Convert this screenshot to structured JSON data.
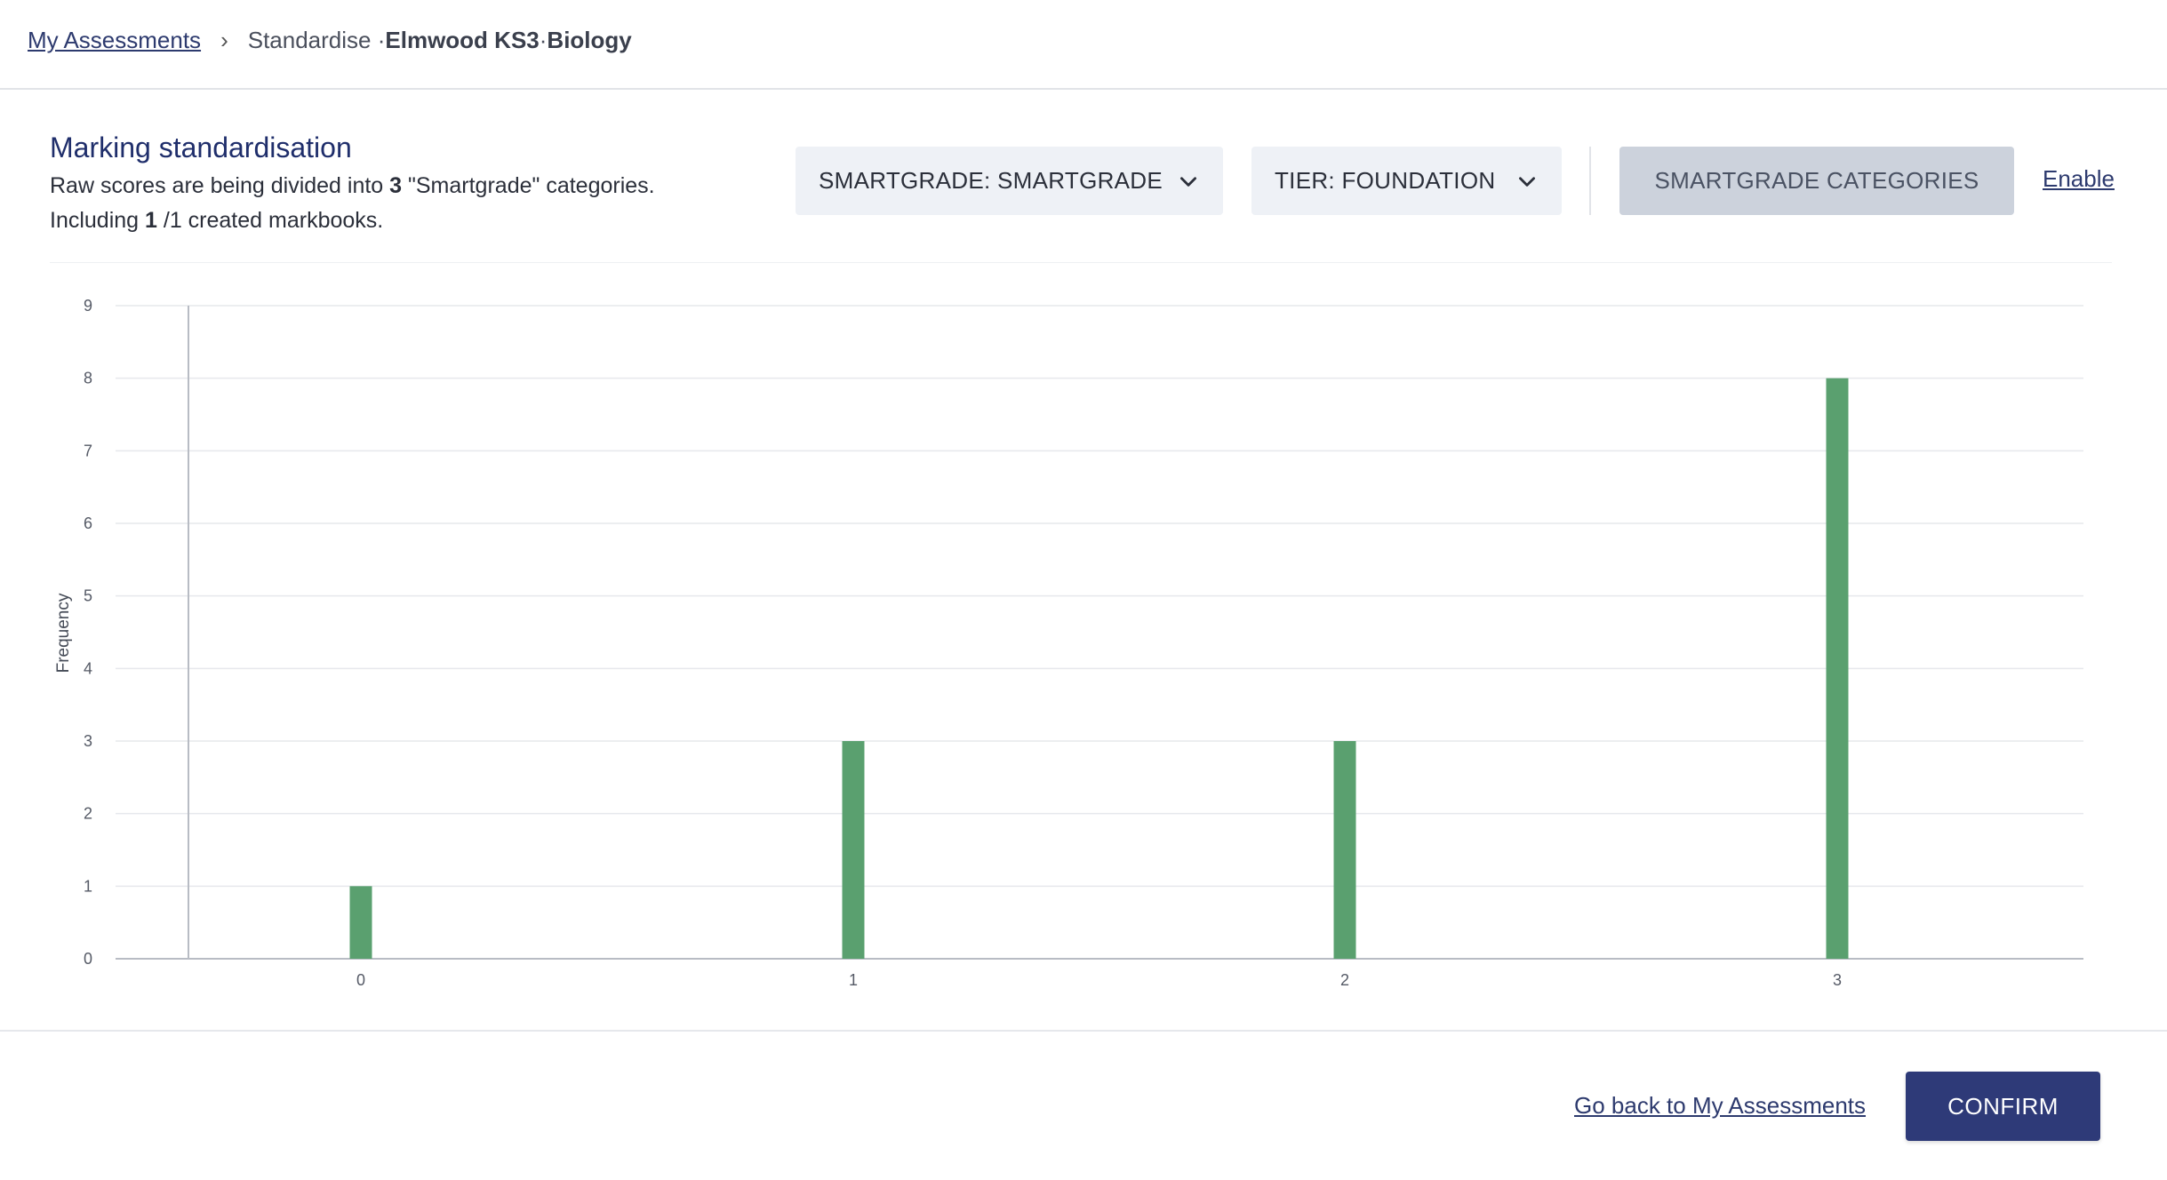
{
  "breadcrumb": {
    "link": "My Assessments",
    "separator": "›",
    "prefix": "Standardise · ",
    "school": "Elmwood KS3",
    "dot": " · ",
    "subject": "Biology"
  },
  "panel": {
    "title": "Marking standardisation",
    "line1_pre": "Raw scores are being divided into ",
    "line1_count": "3",
    "line1_post": " \"Smartgrade\" categories.",
    "line2_pre": "Including ",
    "line2_count": "1",
    "line2_post": " /1 created markbooks."
  },
  "controls": {
    "smartgrade_dropdown": "SMARTGRADE: SMARTGRADE",
    "tier_dropdown": "TIER: FOUNDATION",
    "categories_button": "SMARTGRADE CATEGORIES",
    "enable_link": "Enable"
  },
  "footer": {
    "back_link": "Go back to My Assessments",
    "confirm_button": "CONFIRM"
  },
  "colors": {
    "bar": "#5aa06f",
    "grid": "#e6e8ec",
    "axis": "#b8bcc4",
    "primary": "#2e3a78"
  },
  "chart_data": {
    "type": "bar",
    "categories": [
      "0",
      "1",
      "2",
      "3"
    ],
    "values": [
      1,
      3,
      3,
      8
    ],
    "title": "",
    "xlabel": "",
    "ylabel": "Frequency",
    "ylim": [
      0,
      9
    ],
    "yticks": [
      0,
      1,
      2,
      3,
      4,
      5,
      6,
      7,
      8,
      9
    ],
    "grid": true,
    "legend": "none"
  }
}
